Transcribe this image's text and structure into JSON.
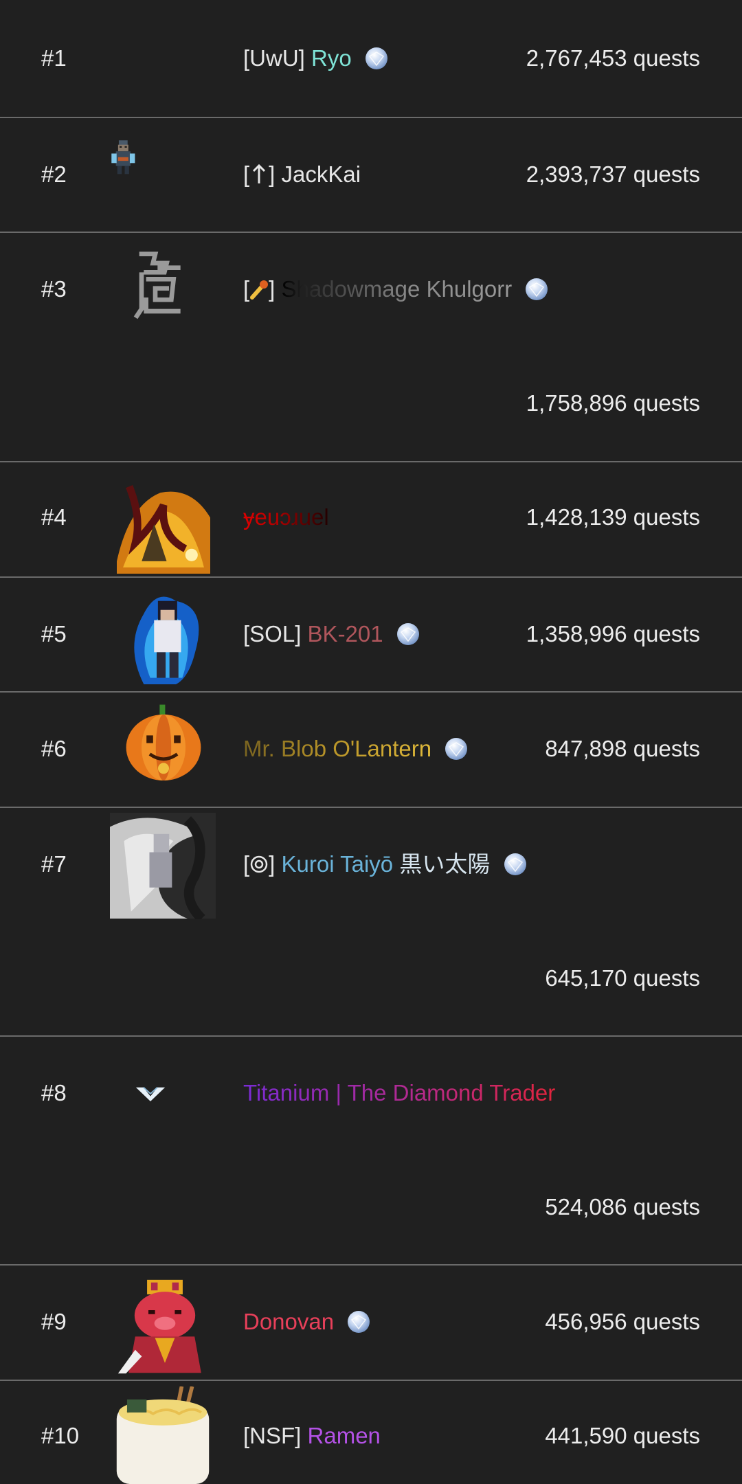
{
  "leaderboard": {
    "unit": "quests",
    "rows": [
      {
        "rank": "#1",
        "tag": "[UwU]",
        "name": "Ryo",
        "name_color": "#7fe3d6",
        "quests": "2,767,453 quests",
        "badge": "gem-icon"
      },
      {
        "rank": "#2",
        "tag_open": "[",
        "tag_close": "]",
        "name": "JackKai",
        "name_color": "#e6e6e6",
        "quests": "2,393,737 quests"
      },
      {
        "rank": "#3",
        "tag_open": "[",
        "tag_close": "]",
        "name": "Shadowmage Khulgorr",
        "name_color": "#9a9a9a",
        "quests": "1,758,896 quests",
        "badge": "gem-icon"
      },
      {
        "rank": "#4",
        "name": "ɏeuɔɹuel",
        "name_color": "#c40000",
        "quests": "1,428,139 quests"
      },
      {
        "rank": "#5",
        "tag": "[SOL]",
        "name": "BK-201",
        "name_color": "#b0565c",
        "quests": "1,358,996 quests",
        "badge": "gem-icon"
      },
      {
        "rank": "#6",
        "name": "Mr. Blob O'Lantern",
        "name_color": "#c9a227",
        "quests": "847,898 quests",
        "badge": "gem-icon"
      },
      {
        "rank": "#7",
        "tag_open": "[",
        "tag_close": "]",
        "name": "Kuroi Taiyō",
        "name_color": "#6ab3d9",
        "name_suffix": "黒い太陽",
        "quests": "645,170 quests",
        "badge": "gem-icon"
      },
      {
        "rank": "#8",
        "name": "Titanium | The Diamond Trader",
        "name_color": "#b0289a",
        "quests": "524,086 quests"
      },
      {
        "rank": "#9",
        "name": "Donovan",
        "name_color": "#e8405a",
        "quests": "456,956 quests",
        "badge": "gem-icon"
      },
      {
        "rank": "#10",
        "tag": "[NSF]",
        "name": "Ramen",
        "name_color": "#b452e6",
        "quests": "441,590 quests"
      }
    ]
  }
}
